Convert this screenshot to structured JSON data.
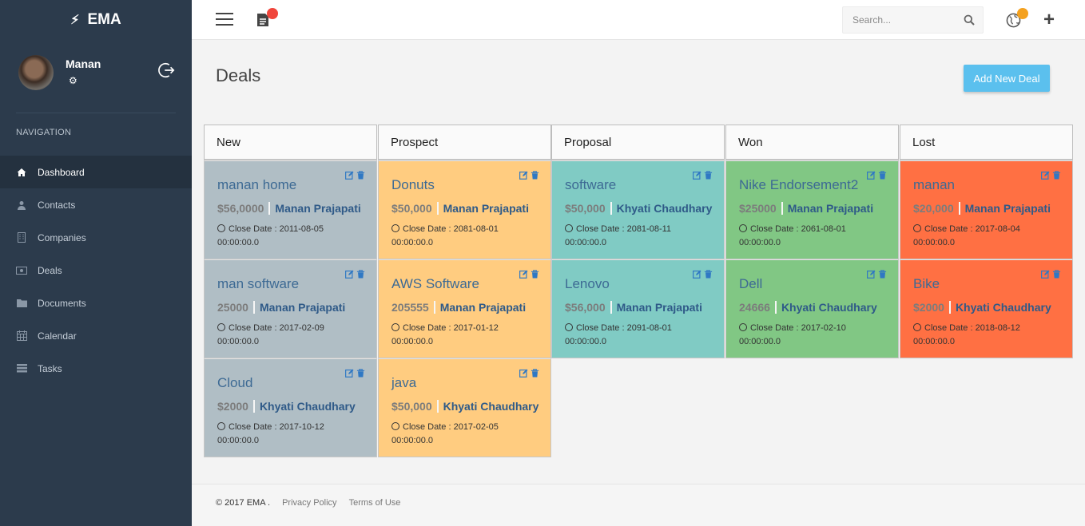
{
  "brand": {
    "name": "EMA"
  },
  "user": {
    "name": "Manan"
  },
  "nav": {
    "title": "NAVIGATION",
    "items": [
      {
        "label": "Dashboard",
        "icon": "home-icon"
      },
      {
        "label": "Contacts",
        "icon": "user-icon"
      },
      {
        "label": "Companies",
        "icon": "building-icon"
      },
      {
        "label": "Deals",
        "icon": "money-icon"
      },
      {
        "label": "Documents",
        "icon": "folder-icon"
      },
      {
        "label": "Calendar",
        "icon": "calendar-icon"
      },
      {
        "label": "Tasks",
        "icon": "tasks-icon"
      }
    ]
  },
  "topbar": {
    "search_placeholder": "Search..."
  },
  "page": {
    "title": "Deals",
    "add_button": "Add New Deal"
  },
  "columns": [
    {
      "title": "New",
      "color": "#b0bec5",
      "deals": [
        {
          "title": "manan home",
          "amount": "$56,0000",
          "owner": "Manan Prajapati",
          "date": "Close Date : 2011-08-05",
          "time": "00:00:00.0"
        },
        {
          "title": "man software",
          "amount": "25000",
          "owner": "Manan Prajapati",
          "date": "Close Date : 2017-02-09",
          "time": "00:00:00.0"
        },
        {
          "title": "Cloud",
          "amount": "$2000",
          "owner": "Khyati Chaudhary",
          "date": "Close Date : 2017-10-12",
          "time": "00:00:00.0"
        }
      ]
    },
    {
      "title": "Prospect",
      "color": "#ffcc80",
      "deals": [
        {
          "title": "Donuts",
          "amount": "$50,000",
          "owner": "Manan Prajapati",
          "date": "Close Date : 2081-08-01",
          "time": "00:00:00.0"
        },
        {
          "title": "AWS Software",
          "amount": "205555",
          "owner": "Manan Prajapati",
          "date": "Close Date : 2017-01-12",
          "time": "00:00:00.0"
        },
        {
          "title": "java",
          "amount": "$50,000",
          "owner": "Khyati Chaudhary",
          "date": "Close Date : 2017-02-05",
          "time": "00:00:00.0"
        }
      ]
    },
    {
      "title": "Proposal",
      "color": "#80cbc4",
      "deals": [
        {
          "title": "software",
          "amount": "$50,000",
          "owner": "Khyati Chaudhary",
          "date": "Close Date : 2081-08-11",
          "time": "00:00:00.0"
        },
        {
          "title": "Lenovo",
          "amount": "$56,000",
          "owner": "Manan Prajapati",
          "date": "Close Date : 2091-08-01",
          "time": "00:00:00.0"
        }
      ]
    },
    {
      "title": "Won",
      "color": "#81c784",
      "deals": [
        {
          "title": "Nike Endorsement2",
          "amount": "$25000",
          "owner": "Manan Prajapati",
          "date": "Close Date : 2061-08-01",
          "time": "00:00:00.0"
        },
        {
          "title": "Dell",
          "amount": "24666",
          "owner": "Khyati Chaudhary",
          "date": "Close Date : 2017-02-10",
          "time": "00:00:00.0"
        }
      ]
    },
    {
      "title": "Lost",
      "color": "#ff7043",
      "deals": [
        {
          "title": "manan",
          "amount": "$20,000",
          "owner": "Manan Prajapati",
          "date": "Close Date : 2017-08-04",
          "time": "00:00:00.0"
        },
        {
          "title": "Bike",
          "amount": "$2000",
          "owner": "Khyati Chaudhary",
          "date": "Close Date : 2018-08-12",
          "time": "00:00:00.0"
        }
      ]
    }
  ],
  "footer": {
    "copyright": "© 2017 EMA .",
    "privacy": "Privacy Policy",
    "terms": "Terms of Use"
  }
}
